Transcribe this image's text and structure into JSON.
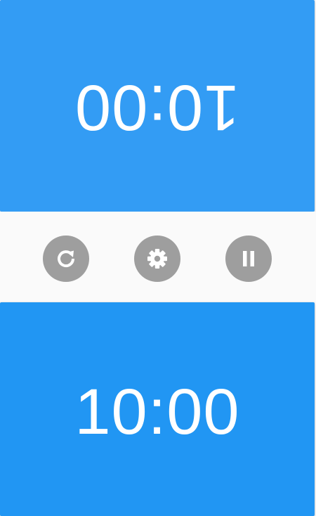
{
  "colors": {
    "top_panel": "#339cf4",
    "bottom_panel": "#2196f3",
    "control_button": "#9e9e9e",
    "control_bar": "#fafafa",
    "icon_fg": "#ffffff"
  },
  "player_top": {
    "time": "10:00",
    "orientation": "upside-down"
  },
  "player_bottom": {
    "time": "10:00"
  },
  "controls": [
    {
      "id": "reset",
      "icon": "restart-icon"
    },
    {
      "id": "settings",
      "icon": "gear-icon"
    },
    {
      "id": "pause",
      "icon": "pause-icon"
    }
  ]
}
